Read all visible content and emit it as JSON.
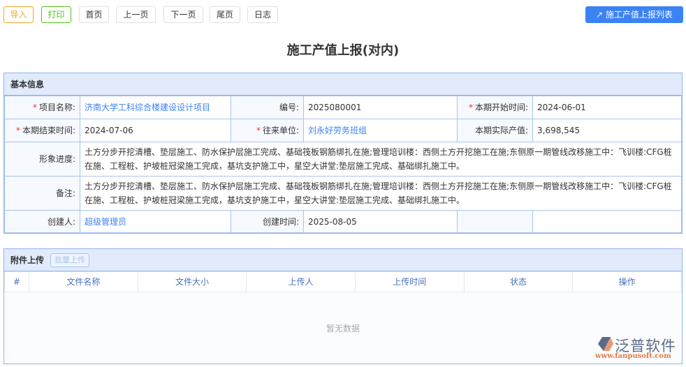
{
  "toolbar": {
    "import": "导入",
    "print": "打印",
    "first": "首页",
    "prev": "上一页",
    "next": "下一页",
    "last": "尾页",
    "log": "日志",
    "list": "施工产值上报列表"
  },
  "title": "施工产值上报(对内)",
  "basic": {
    "heading": "基本信息",
    "project_label": "项目名称:",
    "project": "济南大学工科综合楼建设设计项目",
    "code_label": "编号:",
    "code": "2025080001",
    "start_label": "本期开始时间:",
    "start": "2024-06-01",
    "end_label": "本期结束时间:",
    "end": "2024-07-06",
    "unit_label": "往来单位:",
    "unit": "刘永好劳务班组",
    "output_label": "本期实际产值:",
    "output": "3,698,545",
    "progress_label": "形象进度:",
    "progress": "土方分步开挖清槽、垫层施工、防水保护层施工完成、基础筏板钢筋绑扎在施;管理培训楼：西侧土方开挖施工在施;东侧原一期管线改移施工中：飞训楼:CFG桩在施、工程桩、护坡桩冠梁施工完成，基坑支护施工中，星空大讲堂:垫层施工完成、基础绑扎施工中。",
    "remark_label": "备注:",
    "remark": "土方分步开挖清槽、垫层施工、防水保护层施工完成、基础筏板钢筋绑扎在施;管理培训楼：西侧土方开挖施工在施;东侧原一期管线改移施工中：飞训楼:CFG桩在施、工程桩、护坡桩冠梁施工完成，基坑支护施工中，星空大讲堂:垫层施工完成、基础绑扎施工中。",
    "creator_label": "创建人:",
    "creator": "超级管理员",
    "created_label": "创建时间:",
    "created": "2025-08-05"
  },
  "attach": {
    "heading": "附件上传",
    "batch": "批量上传",
    "columns": [
      "#",
      "文件名称",
      "文件大小",
      "上传人",
      "上传时间",
      "状态",
      "操作"
    ],
    "empty": "暂无数据"
  },
  "logo": {
    "name": "泛普软件",
    "url": "www.fanpusoft.com"
  }
}
